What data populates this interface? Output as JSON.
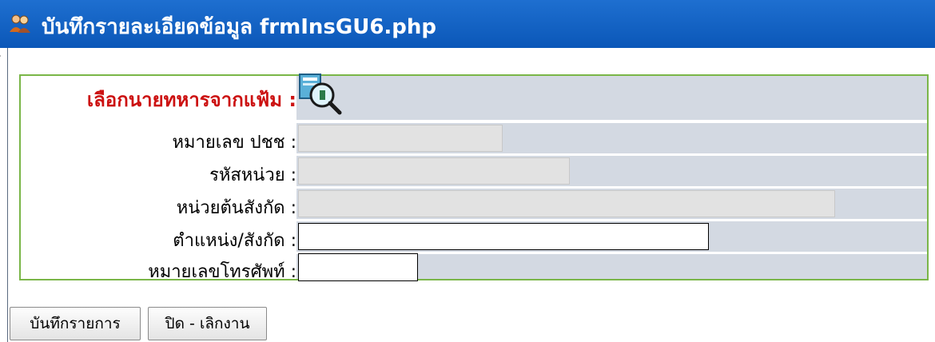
{
  "window": {
    "title": "บันทึกรายละเอียดข้อมูล frmInsGU6.php"
  },
  "form": {
    "pick_label": "เลือกนายทหารจากแฟ้ม :",
    "fields": [
      {
        "label": "หมายเลข ปชช :",
        "value": "",
        "readonly": true
      },
      {
        "label": "รหัสหน่วย :",
        "value": "",
        "readonly": true
      },
      {
        "label": "หน่วยต้นสังกัด :",
        "value": "",
        "readonly": true
      },
      {
        "label": "ตำแหน่ง/สังกัด :",
        "value": "",
        "readonly": false
      },
      {
        "label": "หมายเลขโทรศัพท์ :",
        "value": "",
        "readonly": false
      }
    ]
  },
  "buttons": {
    "save": "บันทึกรายการ",
    "close": "ปิด - เลิกงาน"
  },
  "colors": {
    "titlebar": "#0b57b8",
    "pick_label": "#cc1111",
    "form_border": "#7ab648",
    "cell_bg": "#d3d9e2"
  },
  "icons": {
    "title": "people-icon",
    "pick": "document-search-icon"
  }
}
